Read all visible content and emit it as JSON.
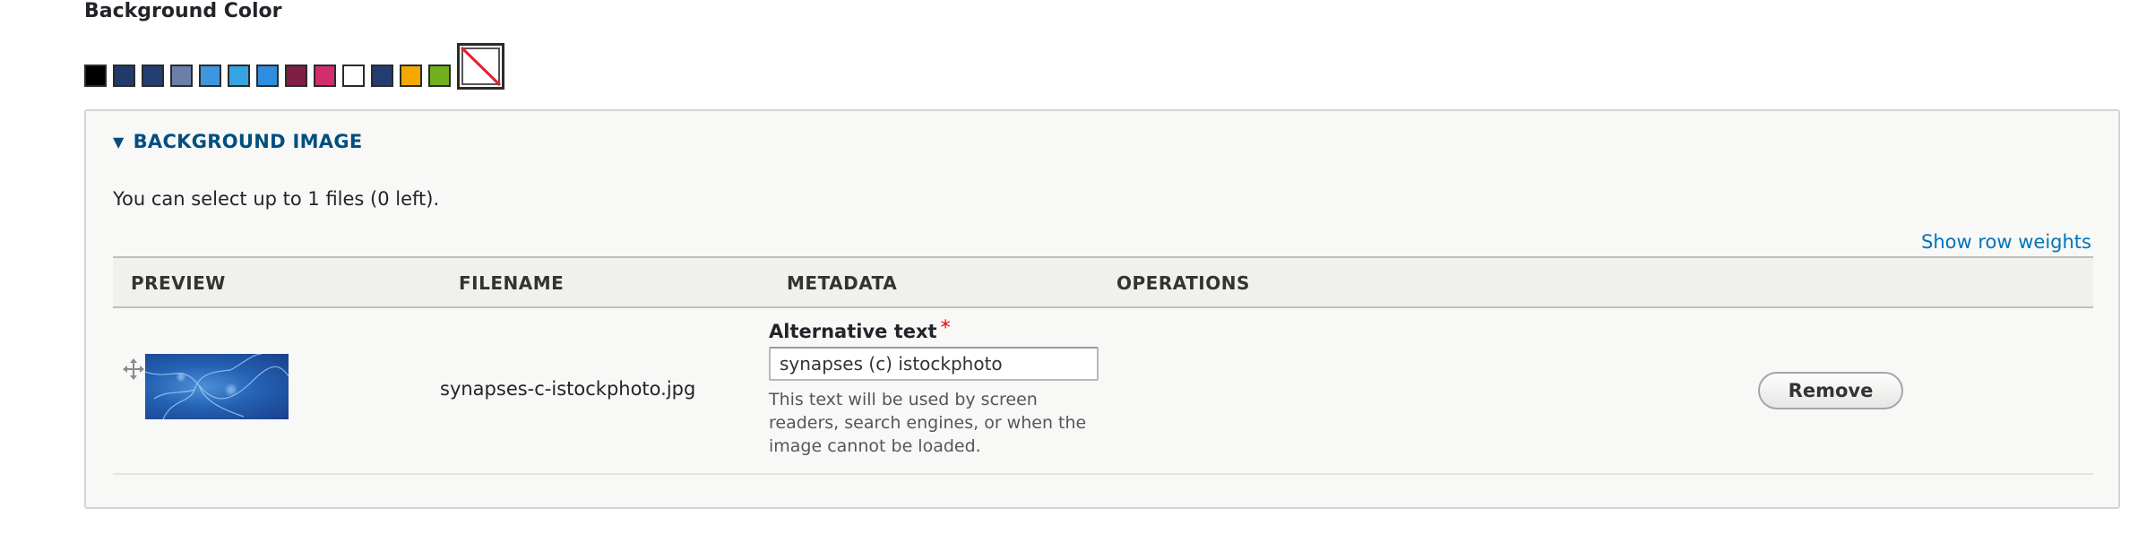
{
  "background_color": {
    "label": "Background Color",
    "swatches": [
      {
        "color": "#000000"
      },
      {
        "color": "#1f3a6b"
      },
      {
        "color": "#243e72"
      },
      {
        "color": "#6b7fa8"
      },
      {
        "color": "#3c97e0"
      },
      {
        "color": "#36a3e2"
      },
      {
        "color": "#2f8ee0"
      },
      {
        "color": "#7f1f46"
      },
      {
        "color": "#d42d6e"
      },
      {
        "color": "#ffffff"
      },
      {
        "color": "#233d74"
      },
      {
        "color": "#f2a900"
      },
      {
        "color": "#72b01d"
      }
    ],
    "none_icon": "no-color-icon"
  },
  "background_image": {
    "summary": "BACKGROUND IMAGE",
    "description": "You can select up to 1 files (0 left).",
    "show_row_weights": "Show row weights",
    "columns": {
      "preview": "PREVIEW",
      "filename": "FILENAME",
      "metadata": "METADATA",
      "operations": "OPERATIONS"
    },
    "rows": [
      {
        "filename": "synapses-c-istockphoto.jpg",
        "alt_label": "Alternative text",
        "required_mark": "*",
        "alt_value": "synapses (c) istockphoto",
        "help": "This text will be used by screen readers, search engines, or when the image cannot be loaded.",
        "remove_label": "Remove"
      }
    ]
  }
}
